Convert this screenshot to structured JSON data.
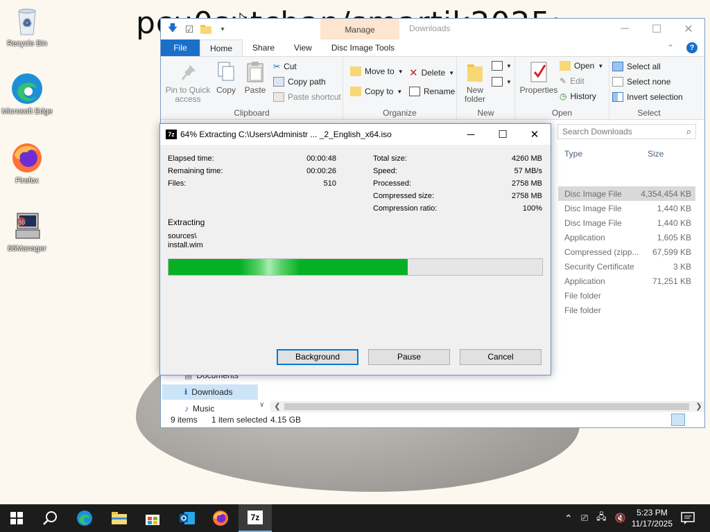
{
  "desktop": {
    "wallpaper_text": "pcu0sutcban/smartik2025:",
    "icons": [
      {
        "label": "Recycle Bin",
        "icon": "recycle-bin-icon"
      },
      {
        "label": "Microsoft Edge",
        "icon": "edge-icon"
      },
      {
        "label": "Firefox",
        "icon": "firefox-icon"
      },
      {
        "label": "86Manager",
        "icon": "86manager-icon"
      }
    ]
  },
  "explorer": {
    "title": "Downloads",
    "context_tab": "Manage",
    "tabs": [
      "File",
      "Home",
      "Share",
      "View",
      "Disc Image Tools"
    ],
    "ribbon": {
      "clipboard": {
        "pin_label": "Pin to Quick access",
        "copy_label": "Copy",
        "paste_label": "Paste",
        "cut_label": "Cut",
        "copy_path_label": "Copy path",
        "paste_shortcut_label": "Paste shortcut",
        "group_label": "Clipboard"
      },
      "organize": {
        "move_to_label": "Move to",
        "copy_to_label": "Copy to",
        "delete_label": "Delete",
        "rename_label": "Rename",
        "group_label": "Organize"
      },
      "new": {
        "new_folder_label": "New folder",
        "group_label": "New"
      },
      "open": {
        "properties_label": "Properties",
        "open_label": "Open",
        "edit_label": "Edit",
        "history_label": "History",
        "group_label": "Open"
      },
      "select": {
        "select_all_label": "Select all",
        "select_none_label": "Select none",
        "invert_label": "Invert selection",
        "group_label": "Select"
      }
    },
    "search_placeholder": "Search Downloads",
    "columns": {
      "type": "Type",
      "size": "Size"
    },
    "files": [
      {
        "type": "Disc Image File",
        "size": "4,354,454 KB",
        "selected": true
      },
      {
        "type": "Disc Image File",
        "size": "1,440 KB"
      },
      {
        "type": "Disc Image File",
        "size": "1,440 KB"
      },
      {
        "type": "Application",
        "size": "1,605 KB"
      },
      {
        "type": "Compressed (zipp...",
        "size": "67,599 KB"
      },
      {
        "type": "Security Certificate",
        "size": "3 KB"
      },
      {
        "type": "Application",
        "size": "71,251 KB"
      },
      {
        "type": "File folder",
        "size": ""
      },
      {
        "type": "File folder",
        "size": ""
      }
    ],
    "nav": [
      {
        "label": "Documents",
        "icon": "documents-icon"
      },
      {
        "label": "Downloads",
        "icon": "downloads-icon",
        "selected": true
      },
      {
        "label": "Music",
        "icon": "music-icon"
      }
    ],
    "status": {
      "items": "9 items",
      "selected": "1 item selected",
      "size": "4.15 GB"
    }
  },
  "extract_dialog": {
    "title": "64% Extracting C:\\Users\\Administr ... _2_English_x64.iso",
    "progress_fraction": 0.64,
    "left_stats": [
      {
        "label": "Elapsed time:",
        "value": "00:00:48"
      },
      {
        "label": "Remaining time:",
        "value": "00:00:26"
      },
      {
        "label": "Files:",
        "value": "510"
      }
    ],
    "right_stats": [
      {
        "label": "Total size:",
        "value": "4260 MB"
      },
      {
        "label": "Speed:",
        "value": "57 MB/s"
      },
      {
        "label": "Processed:",
        "value": "2758 MB"
      },
      {
        "label": "Compressed size:",
        "value": "2758 MB"
      },
      {
        "label": "Compression ratio:",
        "value": "100%"
      }
    ],
    "action": "Extracting",
    "path_line1": "sources\\",
    "path_line2": "install.wim",
    "buttons": {
      "background": "Background",
      "pause": "Pause",
      "cancel": "Cancel"
    }
  },
  "taskbar": {
    "apps": [
      "start-icon",
      "search-icon",
      "edge-icon",
      "file-explorer-icon",
      "store-icon",
      "outlook-icon",
      "firefox-icon",
      "7zip-icon"
    ],
    "time": "5:23 PM",
    "date": "11/17/2025"
  }
}
